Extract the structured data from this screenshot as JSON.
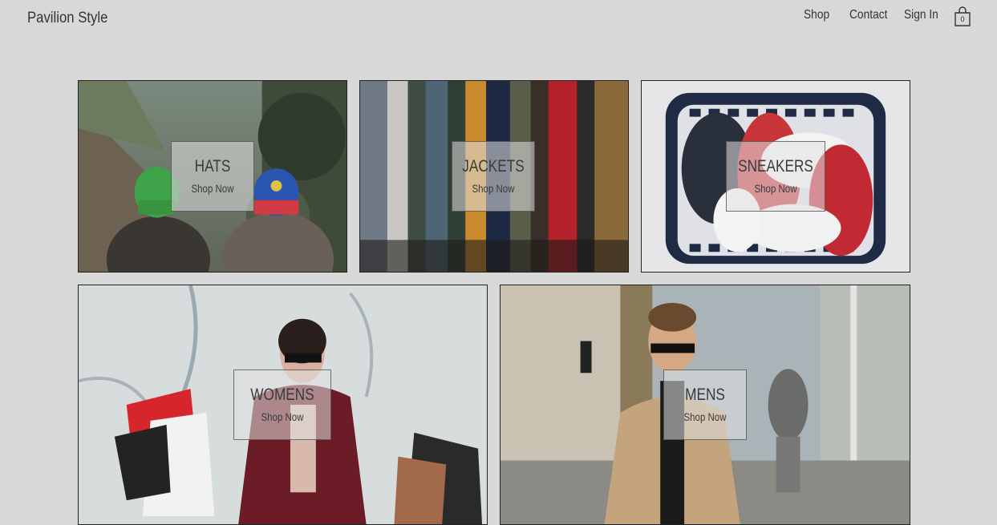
{
  "header": {
    "logo": "Pavilion Style",
    "nav": [
      "Shop",
      "Contact",
      "Sign In"
    ],
    "cart_count": "0"
  },
  "categories": [
    {
      "title": "HATS",
      "cta": "Shop Now"
    },
    {
      "title": "JACKETS",
      "cta": "Shop Now"
    },
    {
      "title": "SNEAKERS",
      "cta": "Shop Now"
    },
    {
      "title": "WOMENS",
      "cta": "Shop Now"
    },
    {
      "title": "MENS",
      "cta": "Shop Now"
    }
  ],
  "icons": {
    "cart": "shopping-bag-icon"
  }
}
